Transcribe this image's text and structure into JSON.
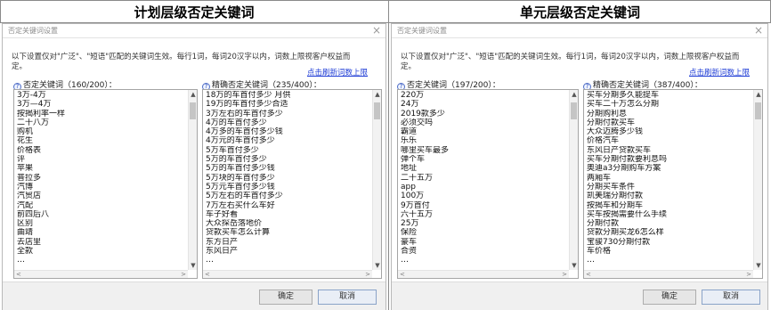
{
  "headings": {
    "left": "计划层级否定关键词",
    "right": "单元层级否定关键词"
  },
  "dialogs": {
    "left": {
      "title": "否定关键词设置",
      "close_glyph": "×",
      "description": "以下设置仅对\"广泛\"、\"短语\"匹配的关键词生效。每行1词，每词20汉字以内，词数上限视客户权益而定。",
      "refresh_link": "点击刷新词数上限",
      "negative": {
        "label": "否定关键词（160/200）：",
        "items": [
          "3万-4万",
          "3万—4万",
          "按揭利率一样",
          "二十八万",
          "购机",
          "花生",
          "价格表",
          "评",
          "苹果",
          "普拉多",
          "汽博",
          "汽贸店",
          "汽配",
          "前四后八",
          "区别",
          "曲靖",
          "去店里",
          "全款",
          "…"
        ]
      },
      "exact": {
        "label": "精确否定关键词（235/400）：",
        "items": [
          "18万的车首付多少 月供",
          "19万的车首付多少合适",
          "3万左右的车首付多少",
          "4万的车首付多少",
          "4万多的车首付多少钱",
          "4万元的车首付多少",
          "5万车首付多少",
          "5万的车首付多少",
          "5万的车首付多少钱",
          "5万块的车首付多少",
          "5万元车首付多少钱",
          "5万左右的车首付多少",
          "7万左右买什么车好",
          "车子好看",
          "大众探岳落地价",
          "贷款买车怎么计算",
          "东方日产",
          "东风日产",
          "…"
        ]
      },
      "buttons": {
        "ok": "确定",
        "cancel": "取消"
      }
    },
    "right": {
      "title": "否定关键词设置",
      "close_glyph": "×",
      "description": "以下设置仅对\"广泛\"、\"短语\"匹配的关键词生效。每行1词，每词20汉字以内，词数上限视客户权益而定。",
      "refresh_link": "点击刷新词数上限",
      "negative": {
        "label": "否定关键词（197/200）：",
        "items": [
          "220万",
          "24万",
          "2019款多少",
          "必须交吗",
          "霸道",
          "乐乐",
          "哪里买车最多",
          "弹个车",
          "地址",
          "二十五万",
          "app",
          "100万",
          "9万首付",
          "六十五万",
          "25万",
          "保险",
          "豪车",
          "合资",
          "…"
        ]
      },
      "exact": {
        "label": "精确否定关键词（387/400）：",
        "items": [
          "买车分期多久能提车",
          "买车二十万怎么分期",
          "分期购利息",
          "分期付款买车",
          "大众迈腾多少钱",
          "价格汽车",
          "东风日产贷款买车",
          "买车分期付款要利息吗",
          "奥迪a3分期购车方案",
          "两厢车",
          "分期买车条件",
          "凯美瑞分期付款",
          "按揭车和分期车",
          "买车按揭需要什么手续",
          "分期付款",
          "贷款分期买龙6怎么样",
          "宝骏730分期付款",
          "车价格",
          "…"
        ]
      },
      "buttons": {
        "ok": "确定",
        "cancel": "取消"
      }
    }
  },
  "icons": {
    "help": "help-circle-icon",
    "close": "close-icon",
    "scroll_up": "chevron-up-icon",
    "scroll_down": "chevron-down-icon"
  },
  "colors": {
    "link": "#1f3dd6",
    "footer_bg": "#f0f0f0",
    "help_icon": "#3555c0"
  }
}
